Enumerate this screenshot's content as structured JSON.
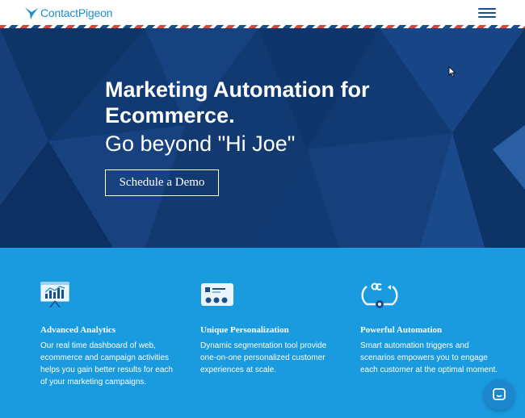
{
  "header": {
    "logo_text": "ContactPigeon",
    "menu_icon": "hamburger-menu-icon"
  },
  "hero": {
    "title": "Marketing Automation for Ecommerce.",
    "subtitle": "Go beyond \"Hi Joe\"",
    "cta_label": "Schedule a Demo"
  },
  "features": [
    {
      "icon": "analytics-chart-icon",
      "title": "Advanced Analytics",
      "description": "Our real time dashboard of web, ecommerce and campaign activities helps you gain better results for each of your marketing campaigns."
    },
    {
      "icon": "personalization-card-icon",
      "title": "Unique Personalization",
      "description": "Dynamic segmentation tool provide one-on-one personalized customer experiences at scale."
    },
    {
      "icon": "automation-flow-icon",
      "title": "Powerful Automation",
      "description": "Smart automation triggers and scenarios empowers you to engage each customer at the optimal moment."
    }
  ],
  "chat": {
    "icon": "chat-bubble-icon"
  },
  "colors": {
    "brand_blue": "#1a8fd0",
    "hero_navy": "#113a72",
    "features_blue": "#1a9be0",
    "stripe_red": "#d9463a"
  }
}
